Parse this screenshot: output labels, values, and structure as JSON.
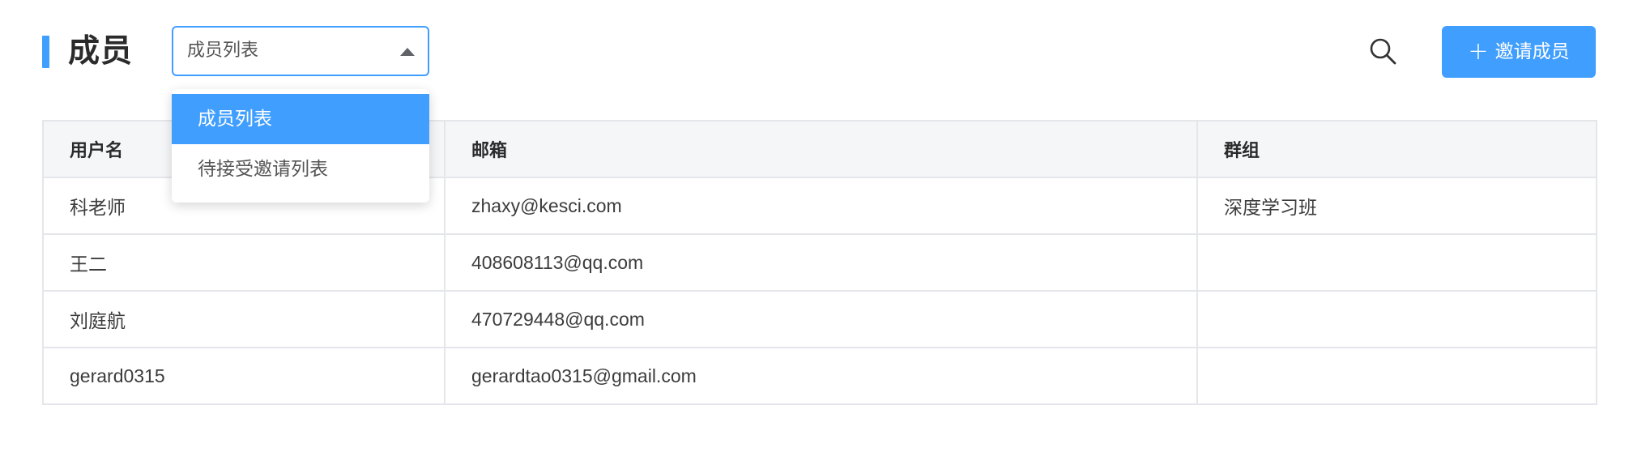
{
  "header": {
    "title": "成员",
    "select": {
      "value": "成员列表",
      "options": [
        "成员列表",
        "待接受邀请列表"
      ],
      "selected_index": 0
    },
    "search_icon": "search-icon",
    "invite_button": {
      "icon": "plus-icon",
      "label": "邀请成员"
    }
  },
  "table": {
    "columns": [
      "用户名",
      "邮箱",
      "群组"
    ],
    "rows": [
      [
        "科老师",
        "zhaxy@kesci.com",
        "深度学习班"
      ],
      [
        "王二",
        "408608113@qq.com",
        ""
      ],
      [
        "刘庭航",
        "470729448@qq.com",
        ""
      ],
      [
        "gerard0315",
        "gerardtao0315@gmail.com",
        ""
      ]
    ]
  },
  "colors": {
    "accent": "#409eff",
    "header_bg": "#f5f6f8",
    "border": "#e4e6ea"
  }
}
